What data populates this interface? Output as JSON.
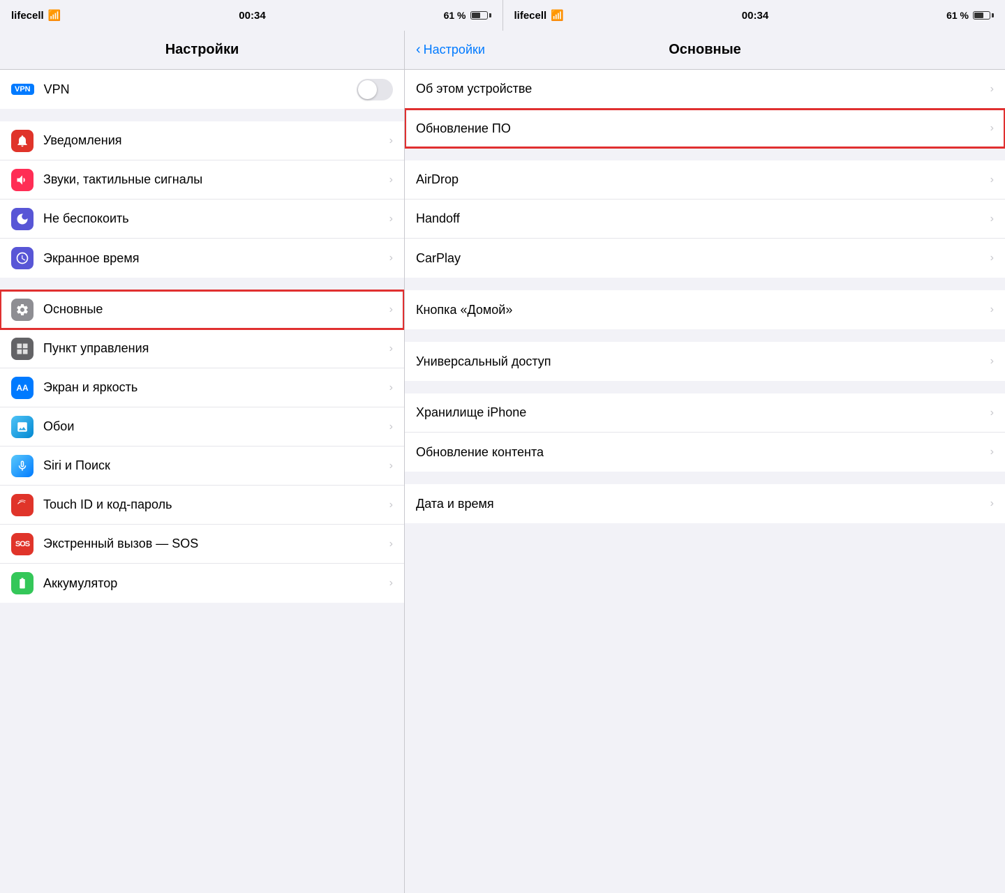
{
  "statusBar": {
    "left": {
      "carrier": "lifecell",
      "time": "00:34",
      "battery_pct": "61 %"
    },
    "right": {
      "carrier": "lifecell",
      "time": "00:34",
      "battery_pct": "61 %"
    }
  },
  "leftPanel": {
    "title": "Настройки",
    "items": [
      {
        "id": "vpn",
        "label": "VPN",
        "icon": "vpn",
        "iconColor": "vpn",
        "hasToggle": true,
        "hasChevron": false
      },
      {
        "id": "notifications",
        "label": "Уведомления",
        "icon": "🔔",
        "iconColor": "icon-red",
        "hasChevron": true
      },
      {
        "id": "sounds",
        "label": "Звуки, тактильные сигналы",
        "icon": "🔊",
        "iconColor": "icon-pink",
        "hasChevron": true
      },
      {
        "id": "do-not-disturb",
        "label": "Не беспокоить",
        "icon": "🌙",
        "iconColor": "icon-indigo",
        "hasChevron": true
      },
      {
        "id": "screen-time",
        "label": "Экранное время",
        "icon": "⏳",
        "iconColor": "icon-purple",
        "hasChevron": true
      },
      {
        "id": "general",
        "label": "Основные",
        "icon": "⚙️",
        "iconColor": "icon-gray",
        "hasChevron": true,
        "highlighted": true
      },
      {
        "id": "control-center",
        "label": "Пункт управления",
        "icon": "🎛",
        "iconColor": "icon-darkgray",
        "hasChevron": true
      },
      {
        "id": "display",
        "label": "Экран и яркость",
        "icon": "AA",
        "iconColor": "icon-blue",
        "hasChevron": true
      },
      {
        "id": "wallpaper",
        "label": "Обои",
        "icon": "🌸",
        "iconColor": "icon-teal",
        "hasChevron": true
      },
      {
        "id": "siri",
        "label": "Siri и Поиск",
        "icon": "🎤",
        "iconColor": "icon-teal",
        "hasChevron": true
      },
      {
        "id": "touch-id",
        "label": "Touch ID и код-пароль",
        "icon": "👆",
        "iconColor": "icon-red",
        "hasChevron": true
      },
      {
        "id": "sos",
        "label": "Экстренный вызов — SOS",
        "icon": "SOS",
        "iconColor": "icon-red",
        "hasChevron": true
      },
      {
        "id": "battery",
        "label": "Аккумулятор",
        "icon": "🔋",
        "iconColor": "icon-green",
        "hasChevron": true
      }
    ]
  },
  "rightPanel": {
    "backLabel": "Настройки",
    "title": "Основные",
    "sections": [
      {
        "items": [
          {
            "id": "about",
            "label": "Об этом устройстве",
            "highlighted": false
          },
          {
            "id": "software-update",
            "label": "Обновление ПО",
            "highlighted": true
          }
        ]
      },
      {
        "items": [
          {
            "id": "airdrop",
            "label": "AirDrop",
            "highlighted": false
          },
          {
            "id": "handoff",
            "label": "Handoff",
            "highlighted": false
          },
          {
            "id": "carplay",
            "label": "CarPlay",
            "highlighted": false
          }
        ]
      },
      {
        "items": [
          {
            "id": "home-button",
            "label": "Кнопка «Домой»",
            "highlighted": false
          }
        ]
      },
      {
        "items": [
          {
            "id": "accessibility",
            "label": "Универсальный доступ",
            "highlighted": false
          }
        ]
      },
      {
        "items": [
          {
            "id": "storage",
            "label": "Хранилище iPhone",
            "highlighted": false
          },
          {
            "id": "content-update",
            "label": "Обновление контента",
            "highlighted": false
          }
        ]
      },
      {
        "items": [
          {
            "id": "date-time",
            "label": "Дата и время",
            "highlighted": false
          }
        ]
      }
    ]
  },
  "icons": {
    "chevron": "›",
    "back_chevron": "‹"
  }
}
